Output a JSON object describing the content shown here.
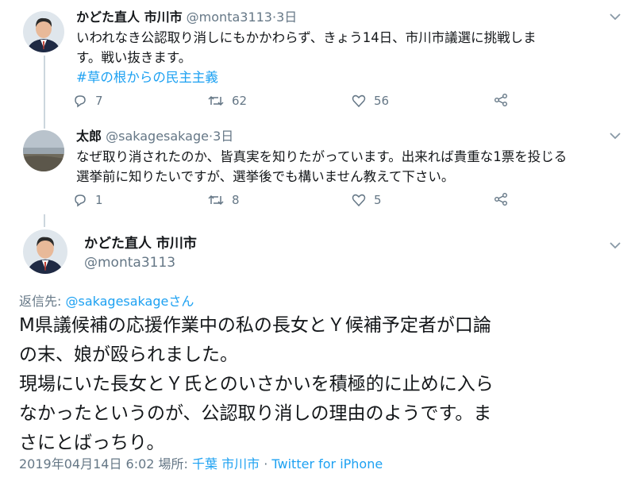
{
  "tweets": [
    {
      "name": "かどた直人 市川市",
      "handle": "@monta3113",
      "sep": "·",
      "time": "3日",
      "text_lines": [
        "いわれなき公認取り消しにもかかわらず、きょう14日、市川市議選に挑戦しま",
        "す。戦い抜きます。"
      ],
      "hashtag": "#草の根からの民主主義",
      "replies": "7",
      "retweets": "62",
      "likes": "56"
    },
    {
      "name": "太郎",
      "handle": "@sakagesakage",
      "sep": "·",
      "time": "3日",
      "text_lines": [
        "なぜ取り消されたのか、皆真実を知りたがっています。出来れば貴重な1票を投じる",
        "選挙前に知りたいですが、選挙後でも構いません教えて下さい。"
      ],
      "replies": "1",
      "retweets": "8",
      "likes": "5"
    }
  ],
  "main_tweet": {
    "name": "かどた直人 市川市",
    "handle": "@monta3113",
    "reply_prefix": "返信先: ",
    "reply_at": "@sakagesakageさん",
    "text_lines": [
      "M県議候補の応援作業中の私の長女とＹ候補予定者が口論",
      "の末、娘が殴られました。",
      "現場にいた長女とＹ氏とのいさかいを積極的に止めに入ら",
      "なかったというのが、公認取り消しの理由のようです。ま",
      "さにとばっちり。"
    ],
    "meta_time": "2019年04月14日 6:02 場所: ",
    "meta_place": "千葉 市川市",
    "meta_sep": " · ",
    "meta_client": "Twitter for iPhone"
  },
  "colors": {
    "text": "#14171a",
    "secondary": "#657786",
    "link": "#1da1f2",
    "thread_line": "#ccd6dd"
  },
  "icons": [
    "reply-icon",
    "retweet-icon",
    "like-icon",
    "share-icon",
    "chevron-down-icon"
  ]
}
